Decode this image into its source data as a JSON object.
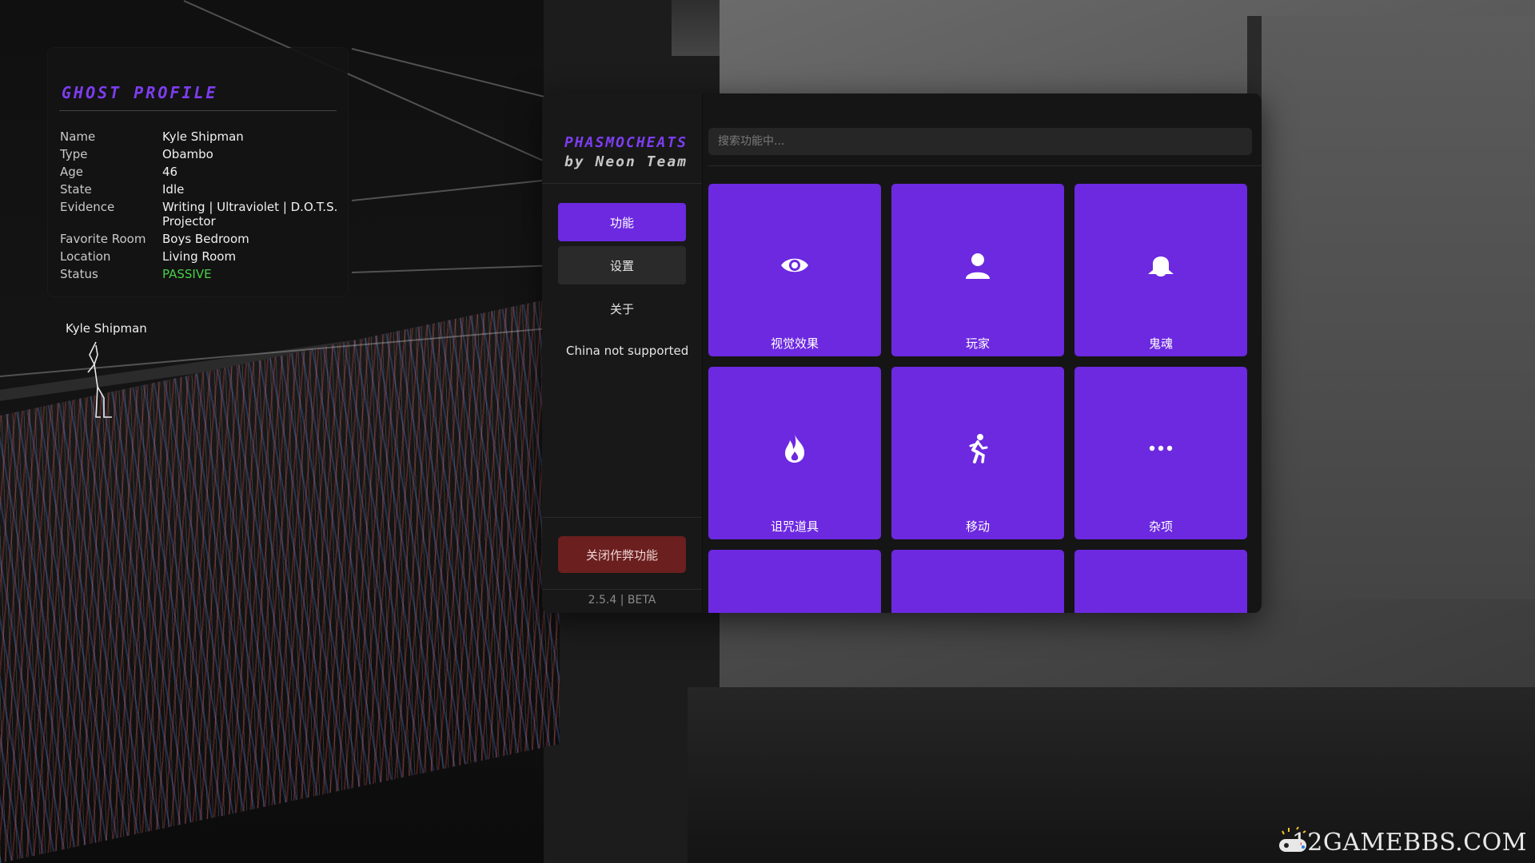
{
  "ghost_profile": {
    "title": "GHOST PROFILE",
    "rows": [
      {
        "key": "Name",
        "value": "Kyle Shipman"
      },
      {
        "key": "Type",
        "value": "Obambo"
      },
      {
        "key": "Age",
        "value": "46"
      },
      {
        "key": "State",
        "value": "Idle"
      },
      {
        "key": "Evidence",
        "value": "Writing | Ultraviolet | D.O.T.S. Projector"
      },
      {
        "key": "Favorite Room",
        "value": "Boys Bedroom"
      },
      {
        "key": "Location",
        "value": "Living Room"
      },
      {
        "key": "Status",
        "value": "PASSIVE"
      }
    ],
    "status_color": "#47d147"
  },
  "ghost_label": "Kyle Shipman",
  "menu": {
    "brand_line1": "PHASMOCHEATS",
    "brand_line2": "by Neon Team",
    "nav": [
      {
        "label": "功能",
        "active": true
      },
      {
        "label": "设置",
        "active": false
      },
      {
        "label": "关于",
        "active": false
      }
    ],
    "note": "China not supported",
    "close_label": "关闭作弊功能",
    "version": "2.5.4 | BETA",
    "search_placeholder": "搜索功能中...",
    "accent_color": "#6c29e0",
    "danger_color": "#6b1f1f",
    "tiles": [
      {
        "label": "视觉效果",
        "icon": "eye-icon"
      },
      {
        "label": "玩家",
        "icon": "user-icon"
      },
      {
        "label": "鬼魂",
        "icon": "ghost-icon"
      },
      {
        "label": "诅咒道具",
        "icon": "fire-icon"
      },
      {
        "label": "移动",
        "icon": "running-icon"
      },
      {
        "label": "杂项",
        "icon": "ellipsis-icon"
      },
      {
        "label": "",
        "icon": ""
      },
      {
        "label": "",
        "icon": ""
      },
      {
        "label": "",
        "icon": ""
      }
    ]
  },
  "watermark": "12GAMEBBS.COM"
}
